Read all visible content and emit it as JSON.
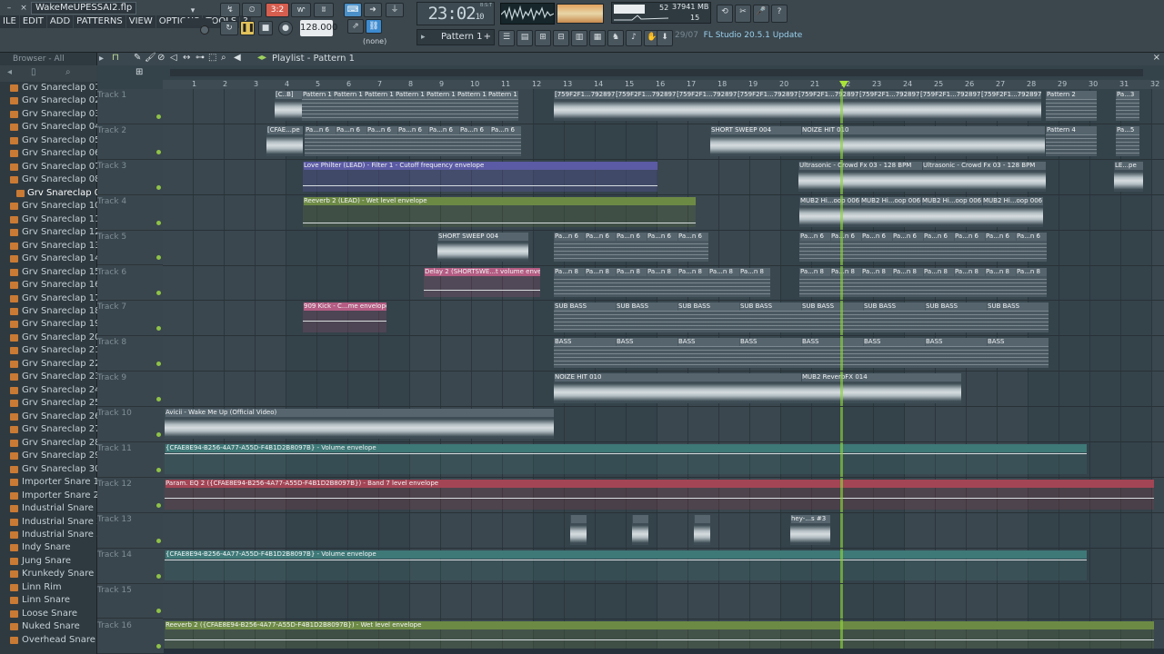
{
  "window": {
    "title": "WakeMeUPESSAI2.flp"
  },
  "menu": [
    "ILE",
    "EDIT",
    "ADD",
    "PATTERNS",
    "VIEW",
    "OPTIONS",
    "TOOLS",
    "?"
  ],
  "transport": {
    "time": "23:02",
    "time_frac": "10",
    "time_unit": "B:S:T",
    "tempo": "128.000",
    "pattern": "Pattern 1",
    "snap": "(none)",
    "ram": "37941 MB",
    "cpu": "52",
    "voices": "15",
    "rec_label": "3:2"
  },
  "hint": {
    "date": "29/07",
    "text": "FL Studio 20.5.1 Update"
  },
  "browser": {
    "header": "Browser - All",
    "selected_index": 8,
    "items": [
      "Grv Snareclap 01",
      "Grv Snareclap 02",
      "Grv Snareclap 03",
      "Grv Snareclap 04",
      "Grv Snareclap 05",
      "Grv Snareclap 06",
      "Grv Snareclap 07",
      "Grv Snareclap 08",
      "Grv Snareclap 09",
      "Grv Snareclap 10",
      "Grv Snareclap 11",
      "Grv Snareclap 12",
      "Grv Snareclap 13",
      "Grv Snareclap 14",
      "Grv Snareclap 15",
      "Grv Snareclap 16",
      "Grv Snareclap 17",
      "Grv Snareclap 18",
      "Grv Snareclap 19",
      "Grv Snareclap 20",
      "Grv Snareclap 21",
      "Grv Snareclap 22",
      "Grv Snareclap 23",
      "Grv Snareclap 24",
      "Grv Snareclap 25",
      "Grv Snareclap 26",
      "Grv Snareclap 27",
      "Grv Snareclap 28",
      "Grv Snareclap 29",
      "Grv Snareclap 30",
      "Importer Snare 1",
      "Importer Snare 2",
      "Industrial Snare 1",
      "Industrial Snare 2",
      "Industrial Snare 3",
      "Indy Snare",
      "Jung Snare",
      "Krunkedy Snare",
      "Linn Rim",
      "Linn Snare",
      "Loose Snare",
      "Nuked Snare",
      "Overhead Snare 1"
    ]
  },
  "playlist": {
    "title": "Playlist - Pattern 1",
    "bars": [
      "1",
      "2",
      "3",
      "4",
      "5",
      "6",
      "7",
      "8",
      "9",
      "10",
      "11",
      "12",
      "13",
      "14",
      "15",
      "16",
      "17",
      "18",
      "19",
      "20",
      "21",
      "22",
      "23",
      "24",
      "25",
      "26",
      "27",
      "28",
      "29",
      "30",
      "31",
      "32",
      "33"
    ],
    "tracks": [
      "Track 1",
      "Track 2",
      "Track 3",
      "Track 4",
      "Track 5",
      "Track 6",
      "Track 7",
      "Track 8",
      "Track 9",
      "Track 10",
      "Track 11",
      "Track 12",
      "Track 13",
      "Track 14",
      "Track 15",
      "Track 16"
    ],
    "clips": {
      "t1_a": "[C..B]",
      "t1_p1": "Pattern 1",
      "t1_aud": "[759F2F1...792897]",
      "t1_p2": "Pattern 2",
      "t1_p3": "Pa...3",
      "t2_a": "[CFAE...pe",
      "t2_pn": "Pa...n 6",
      "t2_sweep": "SHORT SWEEP 004",
      "t2_noize": "NOIZE HIT 010",
      "t2_p4": "Pattern 4",
      "t2_p5": "Pa...5",
      "t3_env": "Love Philter (LEAD) - Filter 1 - Cutoff frequency envelope",
      "t3_ultra": "Ultrasonic - Crowd Fx 03 - 128 BPM",
      "t3_le": "LE...pe",
      "t4_env": "Reeverb 2 (LEAD) - Wet level envelope",
      "t4_mub": "MUB2 Hi...oop 006",
      "t5_sweep": "SHORT SWEEP 004",
      "t5_pn": "Pa...n 6",
      "t6_env": "Delay 2 (SHORTSWE...t volume envelope",
      "t6_pn": "Pa...n 8",
      "t7_env": "909 Kick - C...me envelope",
      "t7_sub": "SUB BASS",
      "t8_bass": "BASS",
      "t9_noize": "NOIZE HIT 010",
      "t9_mub": "MUB2 ReverbFX 014",
      "t10_aud": "Avicii - Wake Me Up (Official Video)",
      "t11_env": "{CFAE8E94-B256-4A77-A55D-F4B1D2B8097B} - Volume envelope",
      "t12_env": "Param. EQ 2 ({CFAE8E94-B256-4A77-A55D-F4B1D2B8097B}) - Band 7 level envelope",
      "t13_hey": "hey-...s #3",
      "t14_env": "{CFAE8E94-B256-4A77-A55D-F4B1D2B8097B} - Volume envelope",
      "t16_env": "Reeverb 2 ({CFAE8E94-B256-4A77-A55D-F4B1D2B8097B}) - Wet level envelope"
    }
  }
}
